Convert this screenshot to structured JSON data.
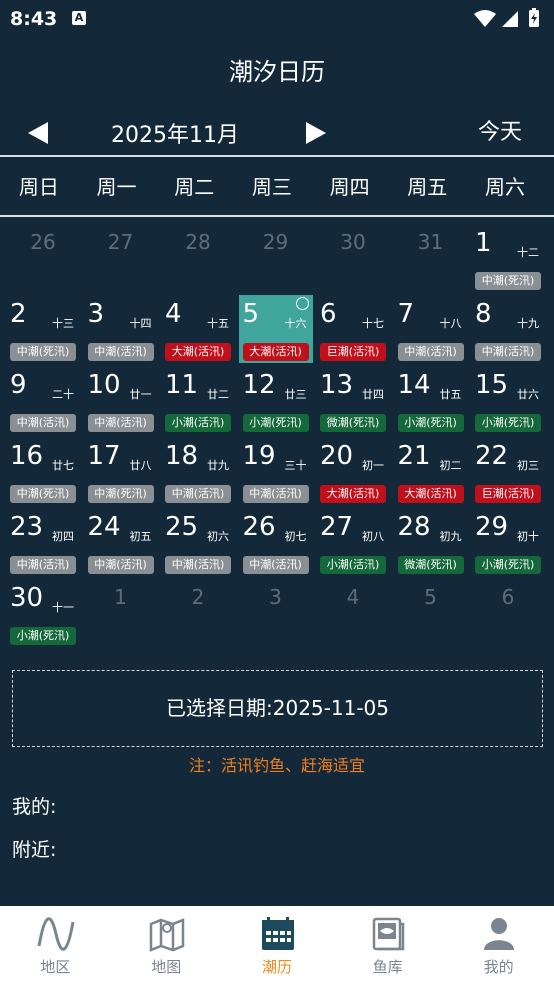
{
  "status": {
    "time": "8:43",
    "a_icon": "A"
  },
  "header": {
    "title": "潮汐日历"
  },
  "nav": {
    "month": "2025年11月",
    "today": "今天"
  },
  "weekdays": [
    "周日",
    "周一",
    "周二",
    "周三",
    "周四",
    "周五",
    "周六"
  ],
  "calendar": [
    {
      "d": "26",
      "out": true
    },
    {
      "d": "27",
      "out": true
    },
    {
      "d": "28",
      "out": true
    },
    {
      "d": "29",
      "out": true
    },
    {
      "d": "30",
      "out": true
    },
    {
      "d": "31",
      "out": true
    },
    {
      "d": "1",
      "l": "十二",
      "t": "中潮(死汛)",
      "c": "gray"
    },
    {
      "d": "2",
      "l": "十三",
      "t": "中潮(死汛)",
      "c": "gray"
    },
    {
      "d": "3",
      "l": "十四",
      "t": "中潮(活汛)",
      "c": "gray"
    },
    {
      "d": "4",
      "l": "十五",
      "t": "大潮(活汛)",
      "c": "red"
    },
    {
      "d": "5",
      "l": "十六",
      "t": "大潮(活汛)",
      "c": "red",
      "sel": true
    },
    {
      "d": "6",
      "l": "十七",
      "t": "巨潮(活汛)",
      "c": "red"
    },
    {
      "d": "7",
      "l": "十八",
      "t": "中潮(活汛)",
      "c": "gray"
    },
    {
      "d": "8",
      "l": "十九",
      "t": "中潮(活汛)",
      "c": "gray"
    },
    {
      "d": "9",
      "l": "二十",
      "t": "中潮(活汛)",
      "c": "gray"
    },
    {
      "d": "10",
      "l": "廿一",
      "t": "中潮(活汛)",
      "c": "gray"
    },
    {
      "d": "11",
      "l": "廿二",
      "t": "小潮(活汛)",
      "c": "green"
    },
    {
      "d": "12",
      "l": "廿三",
      "t": "小潮(死汛)",
      "c": "green"
    },
    {
      "d": "13",
      "l": "廿四",
      "t": "微潮(死汛)",
      "c": "green"
    },
    {
      "d": "14",
      "l": "廿五",
      "t": "小潮(死汛)",
      "c": "green"
    },
    {
      "d": "15",
      "l": "廿六",
      "t": "小潮(死汛)",
      "c": "green"
    },
    {
      "d": "16",
      "l": "廿七",
      "t": "中潮(死汛)",
      "c": "gray"
    },
    {
      "d": "17",
      "l": "廿八",
      "t": "中潮(死汛)",
      "c": "gray"
    },
    {
      "d": "18",
      "l": "廿九",
      "t": "中潮(活汛)",
      "c": "gray"
    },
    {
      "d": "19",
      "l": "三十",
      "t": "中潮(活汛)",
      "c": "gray"
    },
    {
      "d": "20",
      "l": "初一",
      "t": "大潮(活汛)",
      "c": "red"
    },
    {
      "d": "21",
      "l": "初二",
      "t": "大潮(活汛)",
      "c": "red"
    },
    {
      "d": "22",
      "l": "初三",
      "t": "巨潮(活汛)",
      "c": "red"
    },
    {
      "d": "23",
      "l": "初四",
      "t": "中潮(活汛)",
      "c": "gray"
    },
    {
      "d": "24",
      "l": "初五",
      "t": "中潮(活汛)",
      "c": "gray"
    },
    {
      "d": "25",
      "l": "初六",
      "t": "中潮(活汛)",
      "c": "gray"
    },
    {
      "d": "26",
      "l": "初七",
      "t": "中潮(活汛)",
      "c": "gray"
    },
    {
      "d": "27",
      "l": "初八",
      "t": "小潮(活汛)",
      "c": "green"
    },
    {
      "d": "28",
      "l": "初九",
      "t": "微潮(死汛)",
      "c": "green"
    },
    {
      "d": "29",
      "l": "初十",
      "t": "小潮(死汛)",
      "c": "green"
    },
    {
      "d": "30",
      "l": "十一",
      "t": "小潮(死汛)",
      "c": "green"
    },
    {
      "d": "1",
      "out": true
    },
    {
      "d": "2",
      "out": true
    },
    {
      "d": "3",
      "out": true
    },
    {
      "d": "4",
      "out": true
    },
    {
      "d": "5",
      "out": true
    },
    {
      "d": "6",
      "out": true
    }
  ],
  "selected": {
    "text": "已选择日期:2025-11-05"
  },
  "note": "注：活讯钓鱼、赶海适宜",
  "mine": "我的:",
  "nearby": "附近:",
  "tabs": [
    {
      "label": "地区",
      "icon": "wave-icon"
    },
    {
      "label": "地图",
      "icon": "map-icon"
    },
    {
      "label": "潮历",
      "icon": "calendar-icon",
      "active": true
    },
    {
      "label": "鱼库",
      "icon": "fish-book-icon"
    },
    {
      "label": "我的",
      "icon": "person-icon"
    }
  ],
  "colors": {
    "bg": "#13293a",
    "selected": "#3fa59d",
    "gray": "#8a8f94",
    "red": "#c0101c",
    "green": "#14683a",
    "accent": "#f08a1c"
  }
}
